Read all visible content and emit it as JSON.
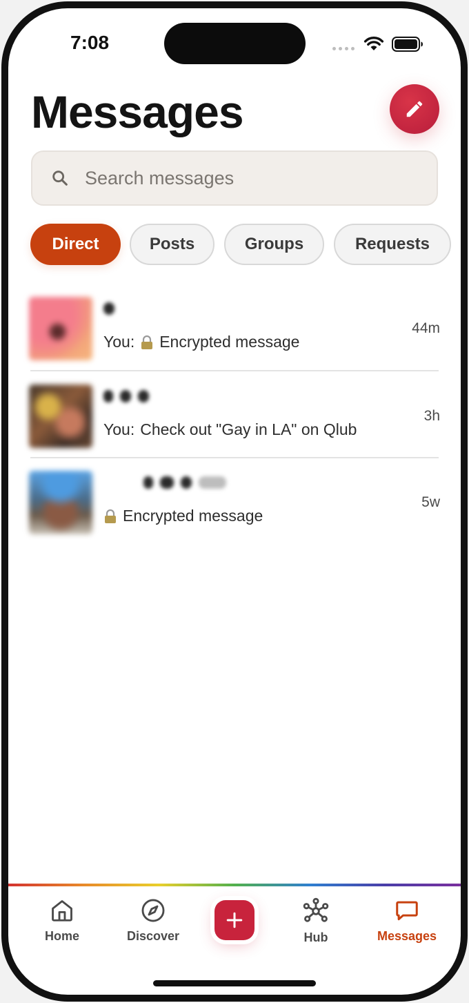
{
  "status_bar": {
    "time": "7:08"
  },
  "header": {
    "title": "Messages"
  },
  "search": {
    "placeholder": "Search messages"
  },
  "tabs": [
    {
      "label": "Direct",
      "active": true
    },
    {
      "label": "Posts",
      "active": false
    },
    {
      "label": "Groups",
      "active": false
    },
    {
      "label": "Requests",
      "active": false
    }
  ],
  "conversations": [
    {
      "prefix": "You:",
      "encrypted": true,
      "preview": "Encrypted message",
      "time": "44m"
    },
    {
      "prefix": "You:",
      "encrypted": false,
      "preview": "Check out \"Gay in LA\" on Qlub",
      "time": "3h"
    },
    {
      "prefix": "",
      "encrypted": true,
      "preview": "Encrypted message",
      "time": "5w"
    }
  ],
  "nav": {
    "home": "Home",
    "discover": "Discover",
    "hub": "Hub",
    "messages": "Messages",
    "active": "messages"
  },
  "colors": {
    "accent": "#c7410f",
    "compose": "#c2243f",
    "add_button": "#c8233c"
  },
  "icons": {
    "compose": "pencil-icon",
    "search": "magnifier-icon",
    "lock": "lock-icon",
    "home": "house-icon",
    "discover": "compass-icon",
    "add": "plus-icon",
    "hub": "network-icon",
    "messages": "chat-bubble-icon"
  }
}
